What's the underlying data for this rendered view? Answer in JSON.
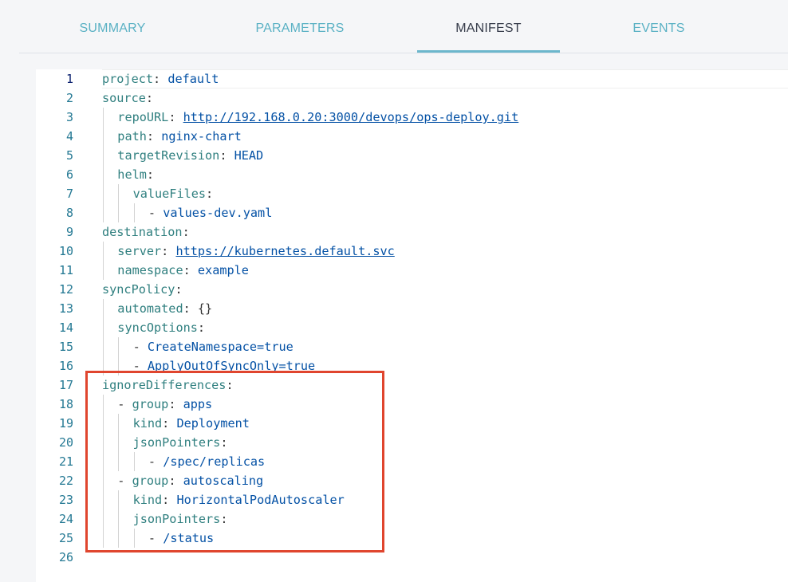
{
  "tabs": [
    {
      "label": "SUMMARY",
      "active": false
    },
    {
      "label": "PARAMETERS",
      "active": false
    },
    {
      "label": "MANIFEST",
      "active": true
    },
    {
      "label": "EVENTS",
      "active": false
    }
  ],
  "editor": {
    "current_line": 1,
    "lines": [
      {
        "n": "1",
        "key": "project",
        "value": "default"
      },
      {
        "n": "2",
        "key": "source"
      },
      {
        "n": "3",
        "key": "repoURL",
        "value": "http://192.168.0.20:3000/devops/ops-deploy.git",
        "link": true
      },
      {
        "n": "4",
        "key": "path",
        "value": "nginx-chart"
      },
      {
        "n": "5",
        "key": "targetRevision",
        "value": "HEAD"
      },
      {
        "n": "6",
        "key": "helm"
      },
      {
        "n": "7",
        "key": "valueFiles"
      },
      {
        "n": "8",
        "value": "values-dev.yaml",
        "dash": true
      },
      {
        "n": "9",
        "key": "destination"
      },
      {
        "n": "10",
        "key": "server",
        "value": "https://kubernetes.default.svc",
        "link": true
      },
      {
        "n": "11",
        "key": "namespace",
        "value": "example"
      },
      {
        "n": "12",
        "key": "syncPolicy"
      },
      {
        "n": "13",
        "key": "automated",
        "value": "{}"
      },
      {
        "n": "14",
        "key": "syncOptions"
      },
      {
        "n": "15",
        "value": "CreateNamespace=true",
        "dash": true
      },
      {
        "n": "16",
        "value": "ApplyOutOfSyncOnly=true",
        "dash": true
      },
      {
        "n": "17",
        "key": "ignoreDifferences"
      },
      {
        "n": "18",
        "key": "group",
        "value": "apps",
        "dash": true
      },
      {
        "n": "19",
        "key": "kind",
        "value": "Deployment"
      },
      {
        "n": "20",
        "key": "jsonPointers"
      },
      {
        "n": "21",
        "value": "/spec/replicas",
        "dash": true
      },
      {
        "n": "22",
        "key": "group",
        "value": "autoscaling",
        "dash": true
      },
      {
        "n": "23",
        "key": "kind",
        "value": "HorizontalPodAutoscaler"
      },
      {
        "n": "24",
        "key": "jsonPointers"
      },
      {
        "n": "25",
        "value": "/status",
        "dash": true
      },
      {
        "n": "26"
      }
    ]
  },
  "colors": {
    "tab_inactive": "#5ab1c4",
    "tab_active": "#363c4a",
    "highlight_border": "#e0452e",
    "yaml_key": "#2f7f7f",
    "yaml_value": "#0451a5"
  }
}
